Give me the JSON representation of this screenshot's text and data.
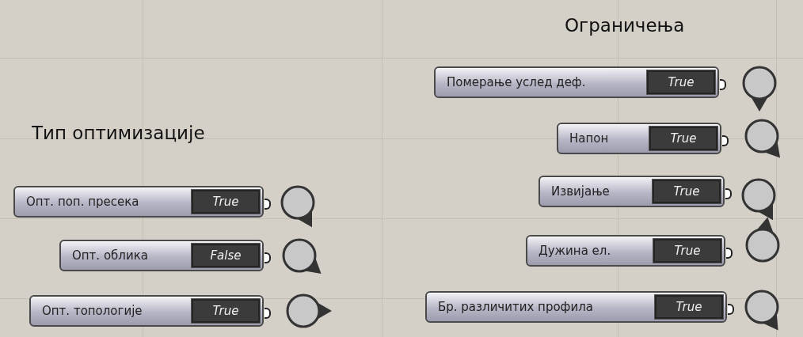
{
  "groups": [
    {
      "title": "Тип оптимизације",
      "toggles": [
        {
          "label": "Опт. поп. пресека",
          "value": "True"
        },
        {
          "label": "Опт. облика",
          "value": "False"
        },
        {
          "label": "Опт. топологије",
          "value": "True"
        }
      ]
    },
    {
      "title": "Ограничења",
      "toggles": [
        {
          "label": "Померање услед деф.",
          "value": "True"
        },
        {
          "label": "Напон",
          "value": "True"
        },
        {
          "label": "Извијање",
          "value": "True"
        },
        {
          "label": "Дужина ел.",
          "value": "True"
        },
        {
          "label": "Бр. различитих профила",
          "value": "True"
        }
      ]
    }
  ]
}
